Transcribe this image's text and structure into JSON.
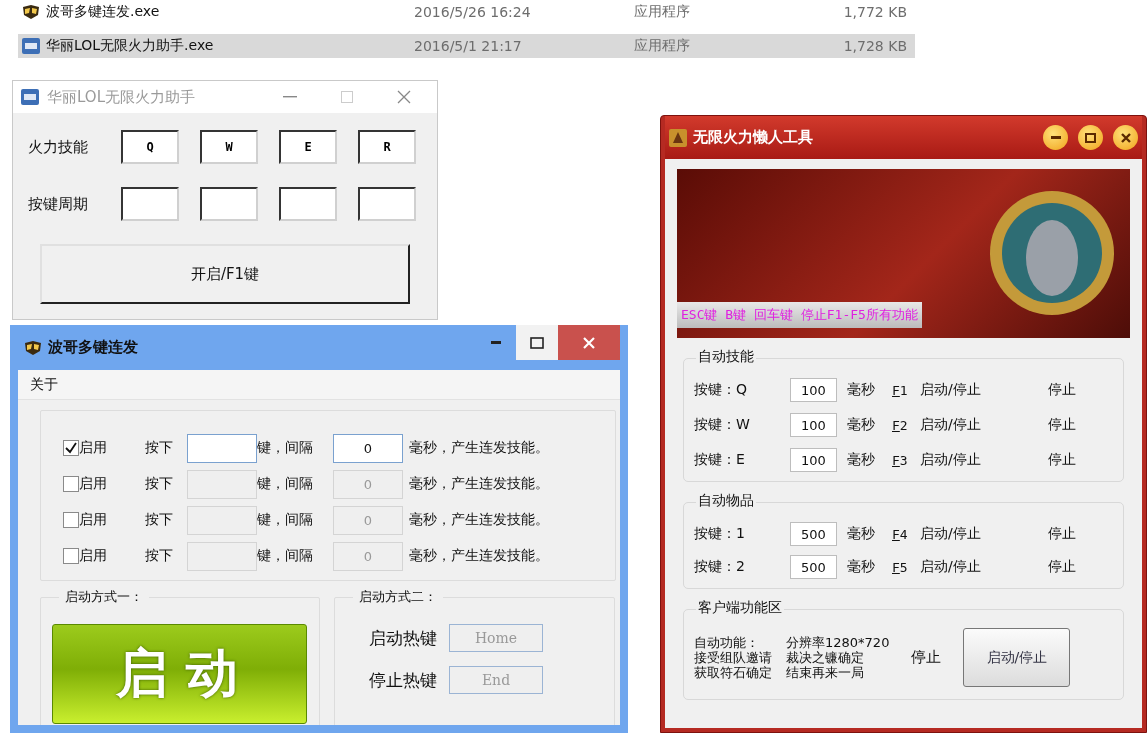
{
  "files": [
    {
      "name": "波哥多键连发.exe",
      "modified": "2016/5/26 16:24",
      "type": "应用程序",
      "size": "1,772 KB",
      "selected": false
    },
    {
      "name": "华丽LOL无限火力助手.exe",
      "modified": "2016/5/1 21:17",
      "type": "应用程序",
      "size": "1,728 KB",
      "selected": true
    }
  ],
  "window_1": {
    "title": "华丽LOL无限火力助手",
    "rows": [
      {
        "kind": "keys",
        "label": "火力技能",
        "fields": [
          "Q",
          "W",
          "E",
          "R"
        ]
      },
      {
        "kind": "blank",
        "label": "按键周期"
      }
    ],
    "button": "开启/F1键"
  },
  "window_2": {
    "title": "波哥多键连发",
    "menu": [
      "关于"
    ],
    "rows": [
      {
        "checked": true,
        "enable_label": "启用",
        "press_label": "按下",
        "key_label": "键，间隔",
        "interval": "0",
        "suffix": "毫秒，产生连发技能。"
      },
      {
        "checked": false,
        "enable_label": "启用",
        "press_label": "按下",
        "key_label": "键，间隔",
        "interval": "0",
        "suffix": "毫秒，产生连发技能。"
      },
      {
        "checked": false,
        "enable_label": "启用",
        "press_label": "按下",
        "key_label": "键，间隔",
        "interval": "0",
        "suffix": "毫秒，产生连发技能。"
      },
      {
        "checked": false,
        "enable_label": "启用",
        "press_label": "按下",
        "key_label": "键，间隔",
        "interval": "0",
        "suffix": "毫秒，产生连发技能。"
      }
    ],
    "mode_1": {
      "title": "启动方式一：",
      "button": "启动"
    },
    "mode_2": {
      "title": "启动方式二：",
      "hotkeys": [
        {
          "label": "启动热键",
          "value": "Home"
        },
        {
          "label": "停止热键",
          "value": "End"
        }
      ]
    }
  },
  "window_3": {
    "title": "无限火力懒人工具",
    "banner_caption": "ESC键 B键 回车键 停止F1-F5所有功能",
    "groups": [
      {
        "title": "自动技能",
        "rows": [
          {
            "label": "按键：Q",
            "value": "100",
            "unit": "毫秒",
            "hotkey": "F1",
            "action": "启动/停止",
            "status": "停止"
          },
          {
            "label": "按键：W",
            "value": "100",
            "unit": "毫秒",
            "hotkey": "F2",
            "action": "启动/停止",
            "status": "停止"
          },
          {
            "label": "按键：E",
            "value": "100",
            "unit": "毫秒",
            "hotkey": "F3",
            "action": "启动/停止",
            "status": "停止"
          }
        ]
      },
      {
        "title": "自动物品",
        "rows": [
          {
            "label": "按键：1",
            "value": "500",
            "unit": "毫秒",
            "hotkey": "F4",
            "action": "启动/停止",
            "status": "停止"
          },
          {
            "label": "按键：2",
            "value": "500",
            "unit": "毫秒",
            "hotkey": "F5",
            "action": "启动/停止",
            "status": "停止"
          }
        ]
      }
    ],
    "client": {
      "title": "客户端功能区",
      "lines": [
        {
          "left": "自动功能：",
          "right": "分辨率1280*720"
        },
        {
          "left": "接受组队邀请",
          "right": "裁决之镰确定"
        },
        {
          "left": "获取符石确定",
          "right": "结束再来一局"
        }
      ],
      "status": "停止",
      "button": "启动/停止"
    }
  }
}
